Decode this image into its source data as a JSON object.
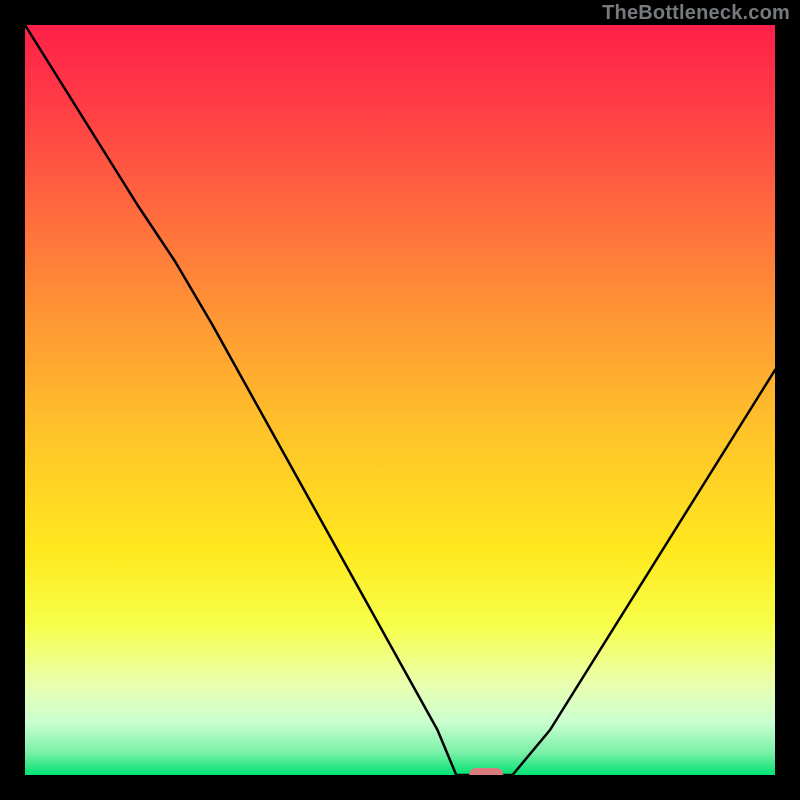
{
  "watermark": {
    "text": "TheBottleneck.com"
  },
  "chart_data": {
    "type": "line",
    "title": "",
    "xlabel": "",
    "ylabel": "",
    "x": [
      0.0,
      0.05,
      0.1,
      0.15,
      0.2,
      0.25,
      0.3,
      0.35,
      0.4,
      0.45,
      0.5,
      0.55,
      0.575,
      0.6,
      0.625,
      0.65,
      0.7,
      0.75,
      0.8,
      0.85,
      0.9,
      0.95,
      1.0
    ],
    "y": [
      1.0,
      0.92,
      0.84,
      0.76,
      0.685,
      0.6,
      0.51,
      0.42,
      0.33,
      0.24,
      0.15,
      0.06,
      0.0,
      0.0,
      0.0,
      0.0,
      0.06,
      0.14,
      0.22,
      0.3,
      0.38,
      0.46,
      0.54
    ],
    "xlim": [
      0,
      1
    ],
    "ylim": [
      0,
      1
    ],
    "marker": {
      "x": 0.615,
      "y": 0.0,
      "label": "optimal-marker"
    },
    "background_gradient": [
      "#ff2a4f",
      "#ffd800",
      "#c8ff8e",
      "#00e272"
    ]
  }
}
